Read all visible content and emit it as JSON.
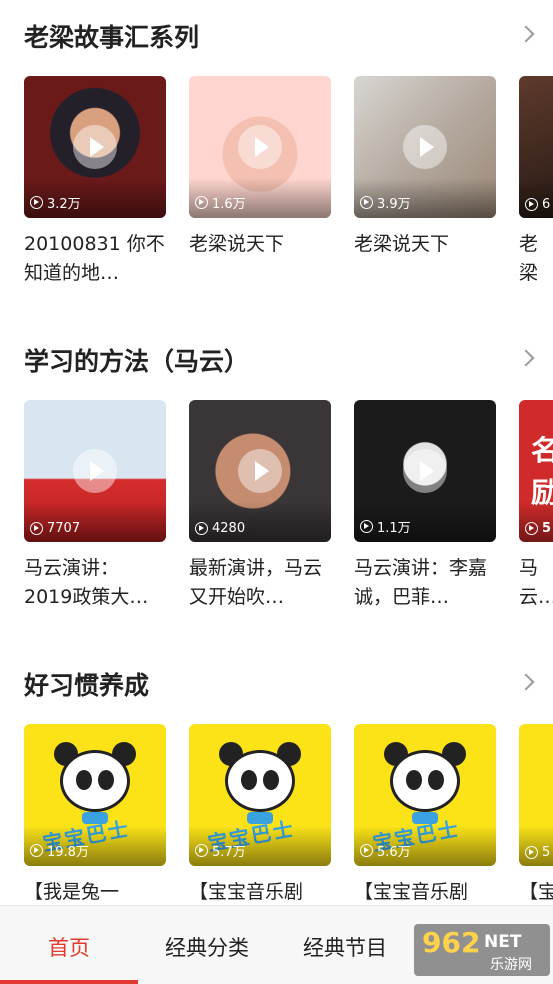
{
  "sections": [
    {
      "title": "老梁故事汇系列",
      "items": [
        {
          "views": "3.2万",
          "title": "20100831 你不知道的地…"
        },
        {
          "views": "1.6万",
          "title": "老梁说天下"
        },
        {
          "views": "3.9万",
          "title": "老梁说天下"
        },
        {
          "views": "6",
          "title": "老梁"
        }
      ]
    },
    {
      "title": "学习的方法（马云）",
      "items": [
        {
          "views": "7707",
          "title": "马云演讲：2019政策大…"
        },
        {
          "views": "4280",
          "title": "最新演讲，马云又开始吹…"
        },
        {
          "views": "1.1万",
          "title": "马云演讲：李嘉诚，巴菲…"
        },
        {
          "views": "5",
          "title": "马云 天真",
          "thumb_text": "名 励"
        }
      ]
    },
    {
      "title": "好习惯养成",
      "items": [
        {
          "views": "19.8万",
          "title": "【我是兔一",
          "thumb_text": "宝宝巴士"
        },
        {
          "views": "5.7万",
          "title": "【宝宝音乐剧",
          "thumb_text": "宝宝巴士"
        },
        {
          "views": "5.6万",
          "title": "【宝宝音乐剧",
          "thumb_text": "宝宝巴士"
        },
        {
          "views": "5",
          "title": "【宝"
        }
      ]
    }
  ],
  "bottom_nav": {
    "items": [
      "首页",
      "经典分类",
      "经典节目"
    ],
    "active": "首页",
    "accent_color": "#e33a2f"
  },
  "watermark": {
    "num": "962",
    "net": "NET",
    "sub": "乐游网"
  }
}
